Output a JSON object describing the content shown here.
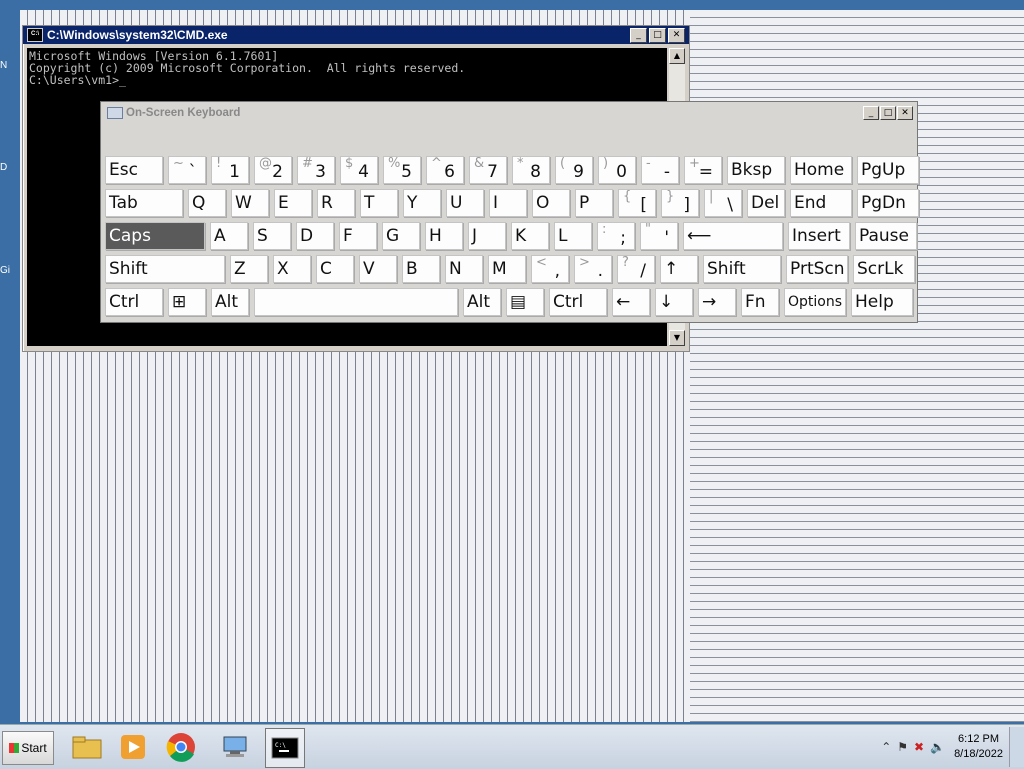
{
  "desktop": {
    "side_labels": [
      "N",
      "D",
      "Gi"
    ]
  },
  "cmd": {
    "title": "C:\\Windows\\system32\\CMD.exe",
    "lines": [
      "Microsoft Windows [Version 6.1.7601]",
      "Copyright (c) 2009 Microsoft Corporation.  All rights reserved.",
      "",
      "C:\\Users\\vm1>_"
    ]
  },
  "osk": {
    "title": "On-Screen Keyboard",
    "rows": [
      [
        {
          "l": "Esc"
        },
        {
          "s": "~",
          "m": "`"
        },
        {
          "s": "!",
          "m": "1"
        },
        {
          "s": "@",
          "m": "2"
        },
        {
          "s": "#",
          "m": "3"
        },
        {
          "s": "$",
          "m": "4"
        },
        {
          "s": "%",
          "m": "5"
        },
        {
          "s": "^",
          "m": "6"
        },
        {
          "s": "&",
          "m": "7"
        },
        {
          "s": "*",
          "m": "8"
        },
        {
          "s": "(",
          "m": "9"
        },
        {
          "s": ")",
          "m": "0"
        },
        {
          "s": "-",
          "m": "-"
        },
        {
          "s": "+",
          "m": "="
        },
        {
          "l": "Bksp"
        },
        {
          "l": "Home"
        },
        {
          "l": "PgUp"
        }
      ],
      [
        {
          "l": "Tab"
        },
        {
          "l": "Q"
        },
        {
          "l": "W"
        },
        {
          "l": "E"
        },
        {
          "l": "R"
        },
        {
          "l": "T"
        },
        {
          "l": "Y"
        },
        {
          "l": "U"
        },
        {
          "l": "I"
        },
        {
          "l": "O"
        },
        {
          "l": "P"
        },
        {
          "s": "{",
          "m": "["
        },
        {
          "s": "}",
          "m": "]"
        },
        {
          "s": "|",
          "m": "\\"
        },
        {
          "l": "Del"
        },
        {
          "l": "End"
        },
        {
          "l": "PgDn"
        }
      ],
      [
        {
          "l": "Caps"
        },
        {
          "l": "A"
        },
        {
          "l": "S"
        },
        {
          "l": "D"
        },
        {
          "l": "F"
        },
        {
          "l": "G"
        },
        {
          "l": "H"
        },
        {
          "l": "J"
        },
        {
          "l": "K"
        },
        {
          "l": "L"
        },
        {
          "s": ":",
          "m": ";"
        },
        {
          "s": "\"",
          "m": "'"
        },
        {
          "l": "⟵"
        },
        {
          "l": "Insert"
        },
        {
          "l": "Pause"
        }
      ],
      [
        {
          "l": "Shift"
        },
        {
          "l": "Z"
        },
        {
          "l": "X"
        },
        {
          "l": "C"
        },
        {
          "l": "V"
        },
        {
          "l": "B"
        },
        {
          "l": "N"
        },
        {
          "l": "M"
        },
        {
          "s": "<",
          "m": ","
        },
        {
          "s": ">",
          "m": "."
        },
        {
          "s": "?",
          "m": "/"
        },
        {
          "l": "↑"
        },
        {
          "l": "Shift"
        },
        {
          "l": "PrtScn"
        },
        {
          "l": "ScrLk"
        }
      ],
      [
        {
          "l": "Ctrl"
        },
        {
          "l": "⊞"
        },
        {
          "l": "Alt"
        },
        {
          "l": ""
        },
        {
          "l": "Alt"
        },
        {
          "l": "▤"
        },
        {
          "l": "Ctrl"
        },
        {
          "l": "←"
        },
        {
          "l": "↓"
        },
        {
          "l": "→"
        },
        {
          "l": "Fn"
        },
        {
          "l": "Options"
        },
        {
          "l": "Help"
        }
      ]
    ]
  },
  "taskbar": {
    "start_label": "Start",
    "time": "6:12 PM",
    "date": "8/18/2022",
    "apps": [
      "explorer",
      "media-player",
      "chrome",
      "network",
      "cmd"
    ]
  }
}
